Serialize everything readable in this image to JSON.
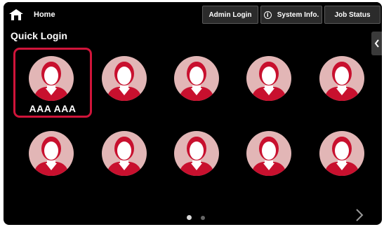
{
  "header": {
    "home_label": "Home",
    "admin_login_label": "Admin Login",
    "system_info_label": "System Info.",
    "job_status_label": "Job Status"
  },
  "section_title": "Quick Login",
  "users": [
    {
      "name": "AAA AAA",
      "selected": true
    },
    {
      "name": "",
      "selected": false
    },
    {
      "name": "",
      "selected": false
    },
    {
      "name": "",
      "selected": false
    },
    {
      "name": "",
      "selected": false
    },
    {
      "name": "",
      "selected": false
    },
    {
      "name": "",
      "selected": false
    },
    {
      "name": "",
      "selected": false
    },
    {
      "name": "",
      "selected": false
    },
    {
      "name": "",
      "selected": false
    }
  ],
  "pagination": {
    "current_page": 1,
    "total_pages": 2
  },
  "colors": {
    "background": "#000000",
    "avatar_circle": "#e2b6b6",
    "avatar_figure": "#c8102e",
    "avatar_face": "#ffffff",
    "selection_border": "#d0143a"
  },
  "icons": {
    "home": "home-icon",
    "info": "info-icon",
    "side_tab": "chevron-left-icon",
    "next_page": "chevron-right-icon",
    "user": "user-avatar-icon"
  }
}
